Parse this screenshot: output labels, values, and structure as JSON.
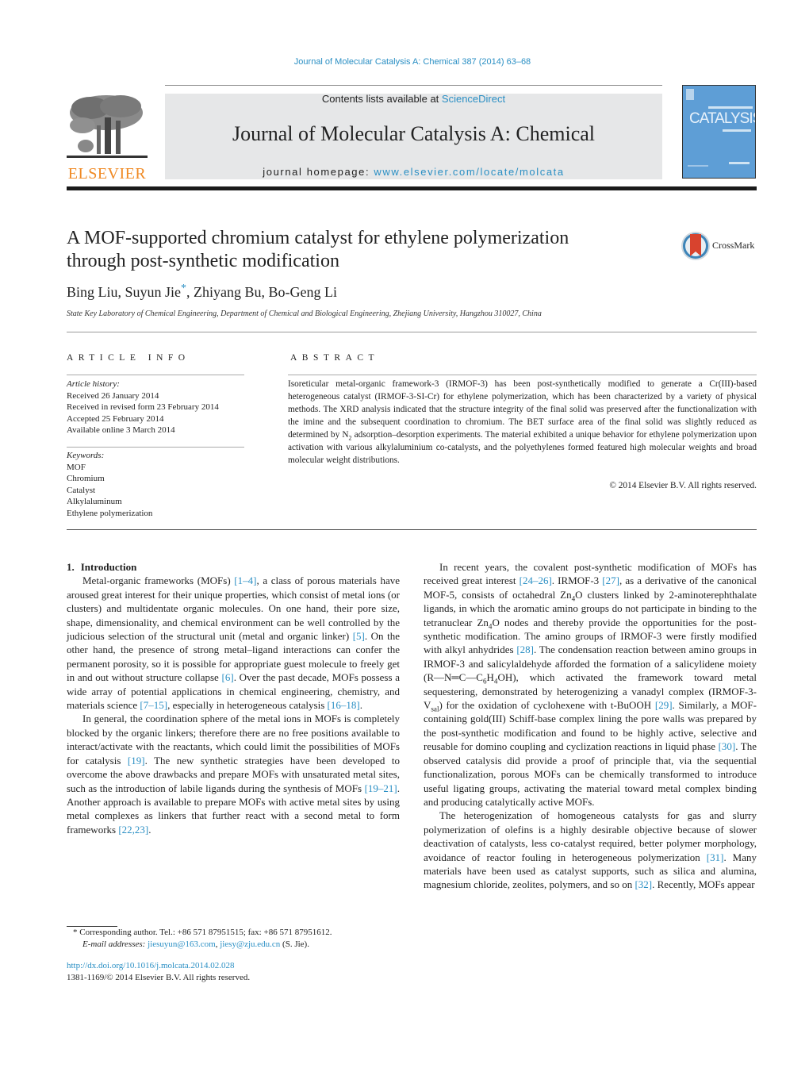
{
  "header": {
    "journal_reference": "Journal of Molecular Catalysis A: Chemical 387 (2014) 63–68",
    "contents_prefix": "Contents lists available at ",
    "contents_link": "ScienceDirect",
    "journal_title": "Journal of Molecular Catalysis A: Chemical",
    "homepage_prefix": "journal homepage: ",
    "homepage_link": "www.elsevier.com/locate/molcata",
    "publisher_logo_text": "ELSEVIER",
    "cover_text": "CATALYSIS",
    "colors": {
      "link": "#2a8fc4",
      "elsevier_orange": "#f08a24",
      "cover_blue": "#5e9ed6",
      "banner_gray": "#e6e7e8"
    }
  },
  "article": {
    "title_line1": "A MOF-supported chromium catalyst for ethylene polymerization",
    "title_line2": "through post-synthetic modification",
    "crossmark_label": "CrossMark",
    "authors": {
      "a1": "Bing Liu, Suyun Jie",
      "star": "*",
      "a2": ", Zhiyang Bu, Bo-Geng Li"
    },
    "affiliation": "State Key Laboratory of Chemical Engineering, Department of Chemical and Biological Engineering, Zhejiang University, Hangzhou 310027, China"
  },
  "article_info": {
    "heading": "ARTICLE INFO",
    "history_label": "Article history:",
    "history": [
      "Received 26 January 2014",
      "Received in revised form 23 February 2014",
      "Accepted 25 February 2014",
      "Available online 3 March 2014"
    ],
    "keywords_label": "Keywords:",
    "keywords": [
      "MOF",
      "Chromium",
      "Catalyst",
      "Alkylaluminum",
      "Ethylene polymerization"
    ]
  },
  "abstract": {
    "heading": "ABSTRACT",
    "text_part1": "Isoreticular metal-organic framework-3 (IRMOF-3) has been post-synthetically modified to generate a Cr(III)-based heterogeneous catalyst (IRMOF-3-SI-Cr) for ethylene polymerization, which has been characterized by a variety of physical methods. The XRD analysis indicated that the structure integrity of the final solid was preserved after the functionalization with the imine and the subsequent coordination to chromium. The BET surface area of the final solid was slightly reduced as determined by N",
    "sub_n2": "2",
    "text_part2": " adsorption–desorption experiments. The material exhibited a unique behavior for ethylene polymerization upon activation with various alkylaluminium co-catalysts, and the polyethylenes formed featured high molecular weights and broad molecular weight distributions.",
    "copyright": "© 2014 Elsevier B.V. All rights reserved."
  },
  "body": {
    "section_number": "1.",
    "section_title": "Introduction",
    "left": {
      "p1": [
        {
          "t": "Metal-organic frameworks (MOFs) "
        },
        {
          "ref": "[1–4]"
        },
        {
          "t": ", a class of porous materials have aroused great interest for their unique properties, which consist of metal ions (or clusters) and multidentate organic molecules. On one hand, their pore size, shape, dimensionality, and chemical environment can be well controlled by the judicious selection of the structural unit (metal and organic linker) "
        },
        {
          "ref": "[5]"
        },
        {
          "t": ". On the other hand, the presence of strong metal–ligand interactions can confer the permanent porosity, so it is possible for appropriate guest molecule to freely get in and out without structure collapse "
        },
        {
          "ref": "[6]"
        },
        {
          "t": ". Over the past decade, MOFs possess a wide array of potential applications in chemical engineering, chemistry, and materials science "
        },
        {
          "ref": "[7–15]"
        },
        {
          "t": ", especially in heterogeneous catalysis "
        },
        {
          "ref": "[16–18]"
        },
        {
          "t": "."
        }
      ],
      "p2": [
        {
          "t": "In general, the coordination sphere of the metal ions in MOFs is completely blocked by the organic linkers; therefore there are no free positions available to interact/activate with the reactants, which could limit the possibilities of MOFs for catalysis "
        },
        {
          "ref": "[19]"
        },
        {
          "t": ". The new synthetic strategies have been developed to overcome the above drawbacks and prepare MOFs with unsaturated metal sites, such as the introduction of labile ligands during the synthesis of MOFs "
        },
        {
          "ref": "[19–21]"
        },
        {
          "t": ". Another approach is available to prepare MOFs with active metal sites by using metal complexes as linkers that further react with a second metal to form frameworks "
        },
        {
          "ref": "[22,23]"
        },
        {
          "t": "."
        }
      ]
    },
    "right": {
      "p1": [
        {
          "t": "In recent years, the covalent post-synthetic modification of MOFs has received great interest "
        },
        {
          "ref": "[24–26]"
        },
        {
          "t": ". IRMOF-3 "
        },
        {
          "ref": "[27]"
        },
        {
          "t": ", as a derivative of the canonical MOF-5, consists of octahedral Zn"
        },
        {
          "sub": "4"
        },
        {
          "t": "O clusters linked by 2-aminoterephthalate ligands, in which the aromatic amino groups do not participate in binding to the tetranuclear Zn"
        },
        {
          "sub": "4"
        },
        {
          "t": "O nodes and thereby provide the opportunities for the post-synthetic modification. The amino groups of IRMOF-3 were firstly modified with alkyl anhydrides "
        },
        {
          "ref": "[28]"
        },
        {
          "t": ". The condensation reaction between amino groups in IRMOF-3 and salicylaldehyde afforded the formation of a salicylidene moiety (R—N═C—C"
        },
        {
          "sub": "6"
        },
        {
          "t": "H"
        },
        {
          "sub": "4"
        },
        {
          "t": "OH), which activated the framework toward metal sequestering, demonstrated by heterogenizing a vanadyl complex (IRMOF-3-V"
        },
        {
          "sub": "sal"
        },
        {
          "t": ") for the oxidation of cyclohexene with t-BuOOH "
        },
        {
          "ref": "[29]"
        },
        {
          "t": ". Similarly, a MOF-containing gold(III) Schiff-base complex lining the pore walls was prepared by the post-synthetic modification and found to be highly active, selective and reusable for domino coupling and cyclization reactions in liquid phase "
        },
        {
          "ref": "[30]"
        },
        {
          "t": ". The observed catalysis did provide a proof of principle that, via the sequential functionalization, porous MOFs can be chemically transformed to introduce useful ligating groups, activating the material toward metal complex binding and producing catalytically active MOFs."
        }
      ],
      "p2": [
        {
          "t": "The heterogenization of homogeneous catalysts for gas and slurry polymerization of olefins is a highly desirable objective because of slower deactivation of catalysts, less co-catalyst required, better polymer morphology, avoidance of reactor fouling in heterogeneous polymerization "
        },
        {
          "ref": "[31]"
        },
        {
          "t": ". Many materials have been used as catalyst supports, such as silica and alumina, magnesium chloride, zeolites, polymers, and so on "
        },
        {
          "ref": "[32]"
        },
        {
          "t": ". Recently, MOFs appear"
        }
      ]
    }
  },
  "footnote": {
    "star": "*",
    "corresponding": "Corresponding author. Tel.: +86 571 87951515; fax: +86 571 87951612.",
    "email_label": "E-mail addresses:",
    "email1": "jiesuyun@163.com",
    "sep": ", ",
    "email2": "jiesy@zju.edu.cn",
    "email_suffix": " (S. Jie).",
    "doi": "http://dx.doi.org/10.1016/j.molcata.2014.02.028",
    "issn": "1381-1169/© 2014 Elsevier B.V. All rights reserved."
  }
}
